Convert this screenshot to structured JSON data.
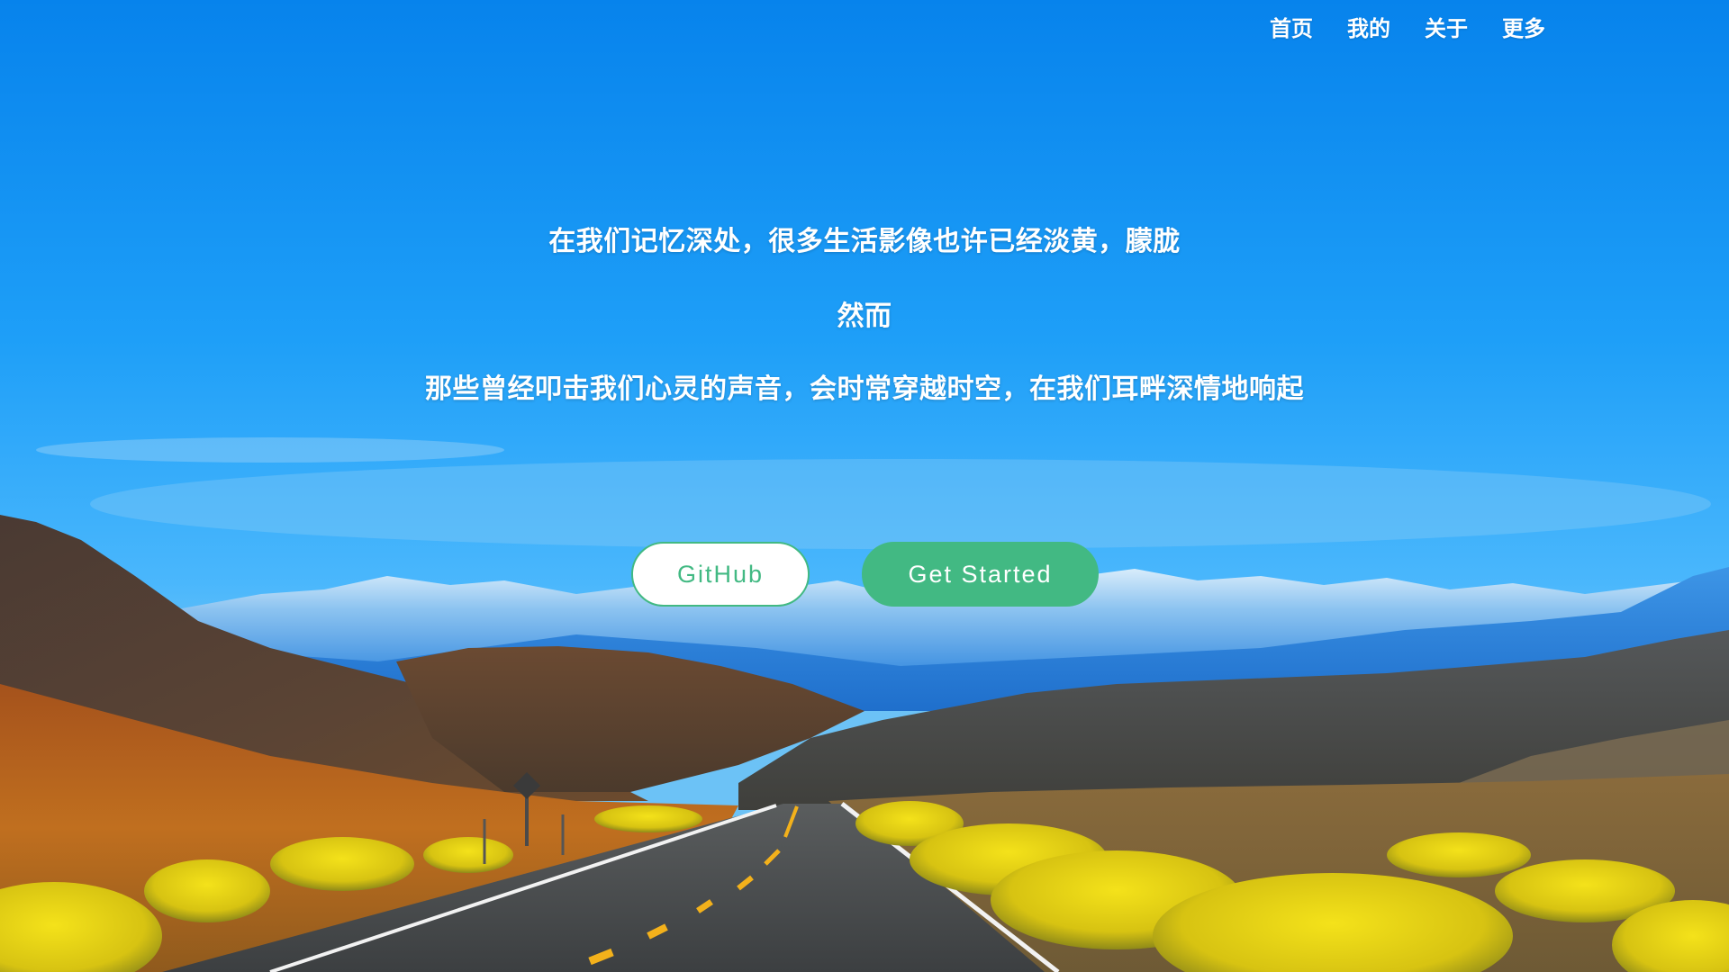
{
  "nav": {
    "items": [
      {
        "label": "首页"
      },
      {
        "label": "我的"
      },
      {
        "label": "关于"
      },
      {
        "label": "更多"
      }
    ]
  },
  "hero": {
    "line1": "在我们记忆深处，很多生活影像也许已经淡黄，朦胧",
    "line2": "然而",
    "line3": "那些曾经叩击我们心灵的声音，会时常穿越时空，在我们耳畔深情地响起"
  },
  "buttons": {
    "github": "GitHub",
    "get_started": "Get Started"
  },
  "colors": {
    "accent": "#42b983",
    "sky": "#1297f5"
  }
}
